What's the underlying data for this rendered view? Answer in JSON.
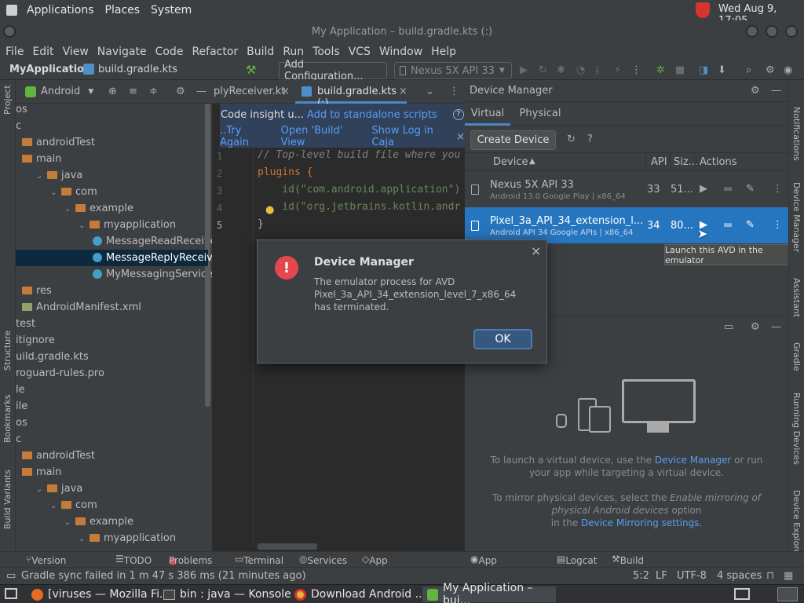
{
  "system_bar": {
    "menus": [
      "Applications",
      "Places",
      "System"
    ],
    "clock": "Wed Aug  9, 17:05"
  },
  "window": {
    "title": "My Application – build.gradle.kts (:)"
  },
  "menubar": {
    "items": [
      "File",
      "Edit",
      "View",
      "Navigate",
      "Code",
      "Refactor",
      "Build",
      "Run",
      "Tools",
      "VCS",
      "Window",
      "Help"
    ]
  },
  "toolbar": {
    "breadcrumb_project": "MyApplication",
    "breadcrumb_file": "build.gradle.kts",
    "config": "Add Configuration...",
    "device": "Nexus 5X API 33"
  },
  "project": {
    "view": "Android",
    "rows": [
      {
        "label": "os",
        "indent": 0,
        "kind": "text"
      },
      {
        "label": "c",
        "indent": 0,
        "kind": "text"
      },
      {
        "label": "androidTest",
        "indent": 0,
        "kind": "folder"
      },
      {
        "label": "main",
        "indent": 0,
        "kind": "folder"
      },
      {
        "label": "java",
        "indent": 1,
        "kind": "folder"
      },
      {
        "label": "com",
        "indent": 2,
        "kind": "folder"
      },
      {
        "label": "example",
        "indent": 3,
        "kind": "folder"
      },
      {
        "label": "myapplication",
        "indent": 4,
        "kind": "folder"
      },
      {
        "label": "MessageReadReceiver",
        "indent": 5,
        "kind": "class"
      },
      {
        "label": "MessageReplyReceiver",
        "indent": 5,
        "kind": "class"
      },
      {
        "label": "MyMessagingService.kt",
        "indent": 5,
        "kind": "class"
      },
      {
        "label": "res",
        "indent": 0,
        "kind": "folder"
      },
      {
        "label": "AndroidManifest.xml",
        "indent": 0,
        "kind": "file"
      },
      {
        "label": "test",
        "indent": 0,
        "kind": "text"
      },
      {
        "label": "itignore",
        "indent": 0,
        "kind": "text"
      },
      {
        "label": "uild.gradle.kts",
        "indent": 0,
        "kind": "text"
      },
      {
        "label": "roguard-rules.pro",
        "indent": 0,
        "kind": "text"
      },
      {
        "label": "le",
        "indent": 0,
        "kind": "text"
      },
      {
        "label": "ile",
        "indent": 0,
        "kind": "text"
      },
      {
        "label": "os",
        "indent": 0,
        "kind": "text"
      },
      {
        "label": "c",
        "indent": 0,
        "kind": "text"
      },
      {
        "label": "androidTest",
        "indent": 0,
        "kind": "folder"
      },
      {
        "label": "main",
        "indent": 0,
        "kind": "folder"
      },
      {
        "label": "java",
        "indent": 1,
        "kind": "folder"
      },
      {
        "label": "com",
        "indent": 2,
        "kind": "folder"
      },
      {
        "label": "example",
        "indent": 3,
        "kind": "folder"
      },
      {
        "label": "myapplication",
        "indent": 4,
        "kind": "folder"
      }
    ]
  },
  "left_strip": {
    "project": "Project",
    "structure": "Structure",
    "bookmarks": "Bookmarks",
    "build_variants": "Build Variants"
  },
  "editor": {
    "tabs": [
      "plyReceiver.kt",
      "build.gradle.kts (:)"
    ],
    "banner1_text": "Code insight u...",
    "banner1_link": "Add to standalone scripts",
    "banner1_help": "?",
    "banner2_links": [
      "..Try Again",
      "Open 'Build' View",
      "Show Log in Caja"
    ],
    "line_numbers": [
      "1",
      "2",
      "3",
      "4",
      "5"
    ],
    "lines": [
      "// Top-level build file where you",
      "plugins {",
      "    id(\"com.android.application\")",
      "    id(\"org.jetbrains.kotlin.andr",
      "}"
    ]
  },
  "device_manager": {
    "title": "Device Manager",
    "tabs": [
      "Virtual",
      "Physical"
    ],
    "create_button": "Create Device",
    "columns": {
      "device": "Device",
      "api": "API",
      "size": "Siz...",
      "actions": "Actions"
    },
    "devices": [
      {
        "name": "Nexus 5X API 33",
        "sub": "Android 13.0 Google Play | x86_64",
        "api": "33",
        "size": "51...",
        "selected": false
      },
      {
        "name": "Pixel_3a_API_34_extension_l...",
        "sub": "Android API 34 Google APIs | x86_64",
        "api": "34",
        "size": "80...",
        "selected": true
      }
    ],
    "tooltip": "Launch this AVD in the emulator"
  },
  "running_devices": {
    "text1_a": "To launch a virtual device, use the ",
    "text1_link": "Device Manager",
    "text1_b": " or run",
    "text1_c": "your app while targeting a virtual device.",
    "text2_a": "To mirror physical devices, select the ",
    "text2_em": "Enable mirroring of",
    "text2_em2": "physical Android devices",
    "text2_b": " option",
    "text2_c": "in the ",
    "text2_link": "Device Mirroring settings",
    "text2_d": "."
  },
  "right_strip": {
    "notifications": "Notifications",
    "device_manager": "Device Manager",
    "assistant": "Assistant",
    "gradle": "Gradle",
    "running_devices": "Running Devices",
    "device_explorer": "Device Explore"
  },
  "dialog": {
    "title": "Device Manager",
    "message_l1": "The emulator process for AVD",
    "message_l2": "Pixel_3a_API_34_extension_level_7_x86_64",
    "message_l3": "has terminated.",
    "ok": "OK"
  },
  "tool_windows": [
    "Version Control",
    "TODO",
    "Problems",
    "Terminal",
    "Services",
    "App Quality Insights",
    "App Inspection",
    "Logcat",
    "Build"
  ],
  "status": {
    "message": "Gradle sync failed in 1 m 47 s 386 ms (21 minutes ago)",
    "position": "5:2",
    "line_sep": "LF",
    "encoding": "UTF-8",
    "indent": "4 spaces"
  },
  "taskbar": {
    "tasks": [
      "[viruses — Mozilla Fi...",
      "bin : java — Konsole",
      "Download Android ...",
      "My Application – bui..."
    ]
  },
  "colors": {
    "accent": "#2675bf",
    "error": "#e5474f",
    "link": "#589df6"
  }
}
